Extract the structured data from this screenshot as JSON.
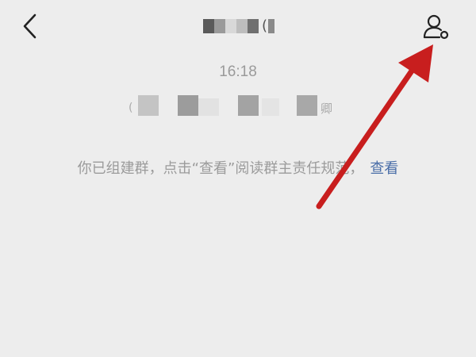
{
  "header": {
    "back_icon": "chevron-left-icon",
    "title_paren": "(",
    "profile_icon": "person-settings-icon"
  },
  "chat": {
    "timestamp": "16:18",
    "blurred_edge_left": "(",
    "blurred_edge_right": "卿",
    "system_message": "你已组建群，点击“查看”阅读群主责任规范，",
    "system_link": "查看"
  },
  "colors": {
    "background": "#ededed",
    "link": "#4a6ea8",
    "annotation_arrow": "#c81e1e"
  }
}
